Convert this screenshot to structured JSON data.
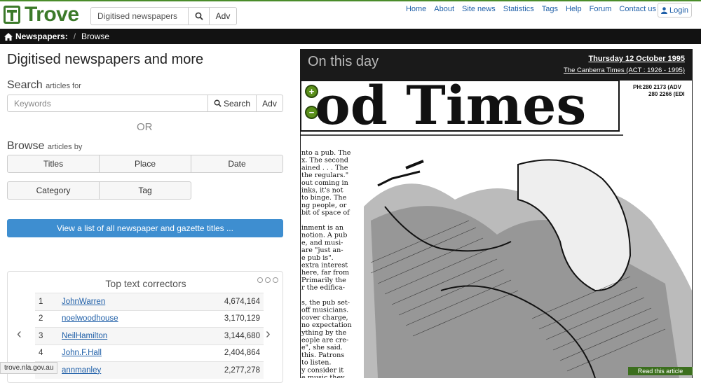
{
  "header": {
    "logo_text": "Trove",
    "search_placeholder": "Digitised newspapers",
    "adv_label": "Adv",
    "nav": [
      "Home",
      "About",
      "Site news",
      "Statistics",
      "Tags",
      "Help",
      "Forum",
      "Contact us"
    ],
    "login_label": "Login"
  },
  "breadcrumb": {
    "section": "Newspapers:",
    "separator": "/",
    "current": "Browse"
  },
  "main": {
    "title": "Digitised newspapers and more",
    "search_heading": "Search",
    "search_sub": "articles for",
    "keywords_placeholder": "Keywords",
    "search_button": "Search",
    "adv_button": "Adv",
    "or_text": "OR",
    "browse_heading": "Browse",
    "browse_sub": "articles by",
    "browse_buttons": [
      "Titles",
      "Place",
      "Date",
      "Category",
      "Tag"
    ],
    "list_all_button": "View a list of all newspaper and gazette titles ..."
  },
  "correctors": {
    "title": "Top text correctors",
    "rows": [
      {
        "rank": "1",
        "name": "JohnWarren",
        "count": "4,674,164"
      },
      {
        "rank": "2",
        "name": "noelwoodhouse",
        "count": "3,170,129"
      },
      {
        "rank": "3",
        "name": "NeilHamilton",
        "count": "3,144,680"
      },
      {
        "rank": "4",
        "name": "John.F.Hall",
        "count": "2,404,864"
      },
      {
        "rank": "5",
        "name": "annmanley",
        "count": "2,277,278"
      }
    ]
  },
  "status_bar": "trove.nla.gov.au",
  "on_this_day": {
    "title": "On this day",
    "date": "Thursday 12 October 1995",
    "paper": "The Canberra Times (ACT : 1926 - 1995)",
    "masthead_fragment": "od Times",
    "phone_text": "PH:280 2173 (ADV\n280 2266 (EDI",
    "article_lines": [
      "nto a pub. The",
      "x. The second",
      "ained . . . The",
      "the regulars.\"",
      "out coming in",
      "inks, it's not",
      "to binge. The",
      "ng people, or",
      "bit of space of",
      "",
      "inment is an",
      "notion. A pub",
      "e, and musi-",
      "are \"just an-",
      "e pub is\".",
      "extra interest",
      "here, far from",
      "Primarily the",
      "r the edifica-",
      "",
      "s, the pub set-",
      "off musicians.",
      "cover charge,",
      "no expectation",
      "ything by the",
      "eople are cre-",
      "e\", she said.",
      "this. Patrons",
      "to listen.",
      "y consider it",
      "e music they"
    ],
    "read_more": "Read this article"
  },
  "colors": {
    "brand_green": "#3c7a2a",
    "link_blue": "#1f5fa8",
    "primary_blue": "#3e8ed0",
    "breadcrumb_bg": "#121212"
  }
}
